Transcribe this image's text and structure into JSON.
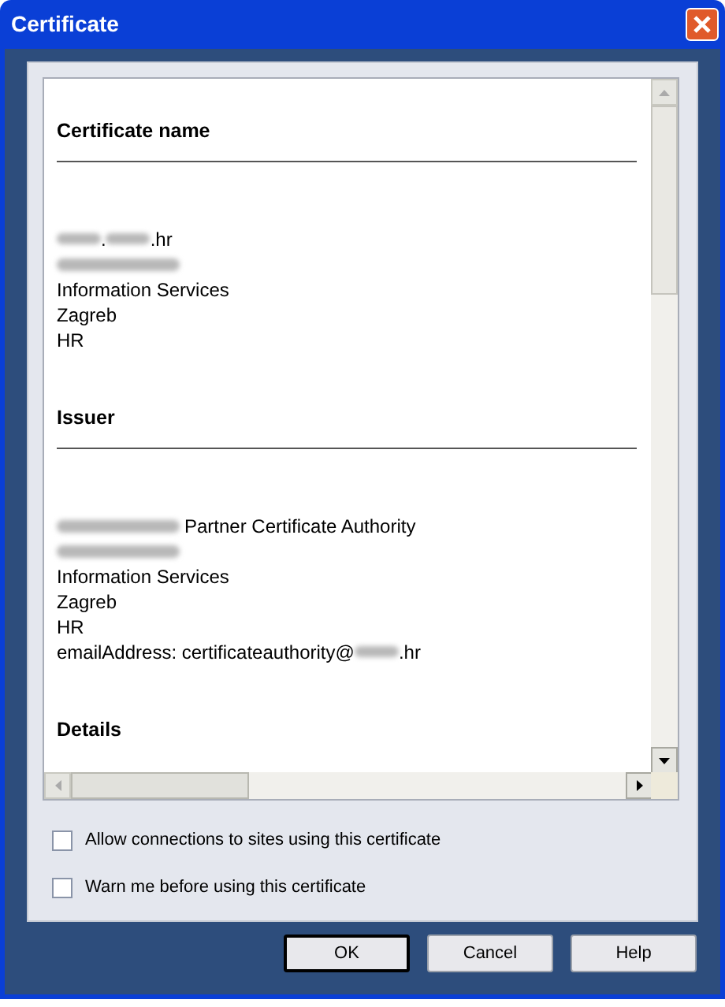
{
  "window": {
    "title": "Certificate"
  },
  "sections": [
    {
      "heading": "Certificate name",
      "lines": [
        [
          {
            "kind": "blur"
          },
          {
            "kind": "text",
            "text": "."
          },
          {
            "kind": "blur"
          },
          {
            "kind": "text",
            "text": ".hr"
          }
        ],
        [
          {
            "kind": "blur_line"
          }
        ],
        [
          {
            "kind": "text",
            "text": "Information Services"
          }
        ],
        [
          {
            "kind": "text",
            "text": "Zagreb"
          }
        ],
        [
          {
            "kind": "text",
            "text": "HR"
          }
        ]
      ]
    },
    {
      "heading": "Issuer",
      "lines": [
        [
          {
            "kind": "blur_line"
          },
          {
            "kind": "text",
            "text": "Partner Certificate Authority"
          }
        ],
        [
          {
            "kind": "blur_line"
          }
        ],
        [
          {
            "kind": "text",
            "text": "Information Services"
          }
        ],
        [
          {
            "kind": "text",
            "text": "Zagreb"
          }
        ],
        [
          {
            "kind": "text",
            "text": "HR"
          }
        ],
        [
          {
            "kind": "text",
            "text": "emailAddress: certificateauthority@"
          },
          {
            "kind": "blur"
          },
          {
            "kind": "text",
            "text": ".hr"
          }
        ]
      ]
    },
    {
      "heading": "Details"
    }
  ],
  "checkboxes": [
    {
      "label": "Allow connections to sites using this certificate",
      "checked": false
    },
    {
      "label": "Warn me before using this certificate",
      "checked": false
    }
  ],
  "buttons": [
    {
      "label": "OK",
      "default": true
    },
    {
      "label": "Cancel",
      "default": false
    },
    {
      "label": "Help",
      "default": false
    }
  ]
}
